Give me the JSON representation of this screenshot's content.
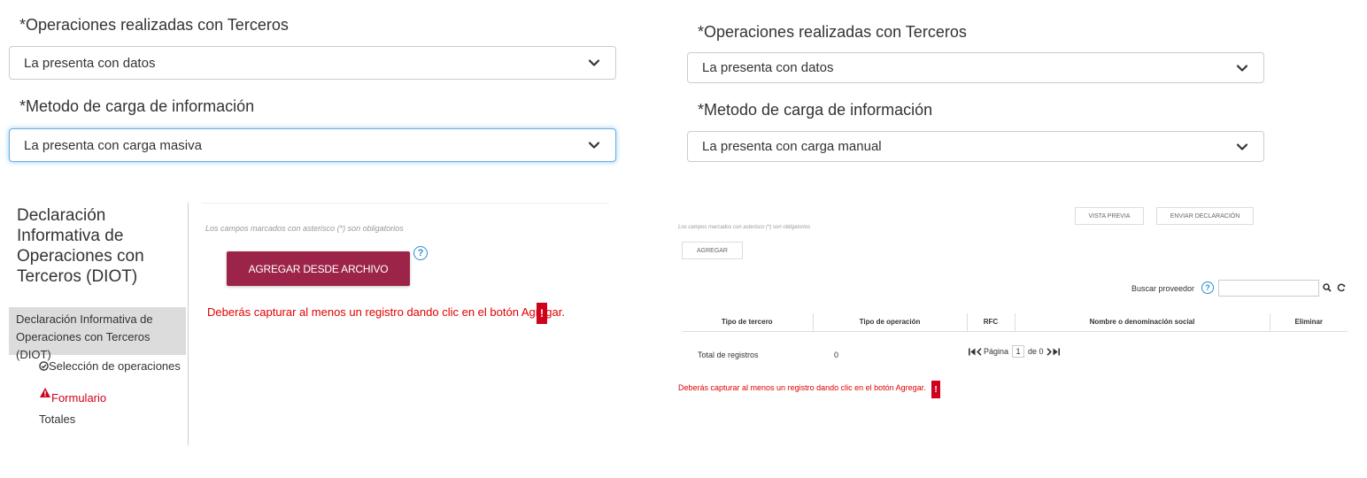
{
  "left": {
    "ops_label": "*Operaciones realizadas con Terceros",
    "ops_value": "La presenta con datos",
    "method_label": "*Metodo de carga de información",
    "method_value": "La presenta con carga masiva",
    "sidebar": {
      "title": "Declaración Informativa de Operaciones con Terceros (DIOT)",
      "active_item": "Declaración Informativa de Operaciones con Terceros (DIOT)",
      "items": [
        {
          "label": "Selección de operaciones",
          "icon": "check-circle-icon"
        },
        {
          "label": "Formulario",
          "icon": "warning-triangle-icon"
        },
        {
          "label": "Totales"
        }
      ]
    },
    "hint": "Los campos marcados con asterisco (*) son obligatorios",
    "add_file_button": "AGREGAR DESDE ARCHIVO",
    "help_glyph": "?",
    "error": "Deberás capturar al menos un registro dando clic en el botón Agregar.",
    "error_glyph": "!"
  },
  "right": {
    "ops_label": "*Operaciones realizadas con Terceros",
    "ops_value": "La presenta con datos",
    "method_label": "*Metodo de carga de información",
    "method_value": "La presenta con carga manual",
    "preview_button": "VISTA PREVIA",
    "send_button": "ENVIAR DECLARACIÓN",
    "hint": "Los campos marcados con asterisco (*) son obligatorios",
    "add_button": "AGREGAR",
    "search_label": "Buscar proveedor",
    "help_glyph": "?",
    "table": {
      "headers": [
        "Tipo de tercero",
        "Tipo de operación",
        "RFC",
        "Nombre o denominación social",
        "Eliminar"
      ]
    },
    "total_label": "Total de registros",
    "total_value": "0",
    "pager": {
      "page_label": "Página",
      "page": "1",
      "of_label": "de 0"
    },
    "error": "Deberás capturar al menos un registro dando clic en el botón Agregar.",
    "error_glyph": "!"
  },
  "colors": {
    "primary": "#9d2449",
    "error": "#e10000",
    "help": "#2a8fcc",
    "focus": "#66afe9"
  }
}
